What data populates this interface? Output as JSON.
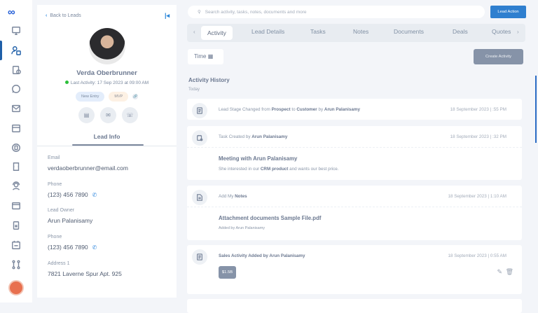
{
  "sidebar": {
    "logo": "GO",
    "icons": [
      "dashboard-icon",
      "leads-icon",
      "invoice-icon",
      "whatsapp-icon",
      "mail-icon",
      "store-icon",
      "document-icon",
      "ticket-icon",
      "support-icon",
      "browser-icon",
      "report-icon",
      "calendar-icon",
      "workflow-icon"
    ],
    "active": "leads-icon"
  },
  "lead": {
    "back": "Back to Leads",
    "name": "Verda Oberbrunner",
    "last_activity": "Last Activity: 17 Sep 2023 at 09:00 AM",
    "tags": [
      "New Entry",
      "MVP"
    ],
    "section": "Lead Info",
    "fields": [
      {
        "label": "Email",
        "value": "verdaoberbrunner@email.com"
      },
      {
        "label": "Phone",
        "value": "(123) 456 7890"
      },
      {
        "label": "Lead Owner",
        "value": "Arun Palanisamy"
      },
      {
        "label": "Phone",
        "value": "(123) 456 7890"
      },
      {
        "label": "Address 1",
        "value": "7821 Laverne Spur Apt. 925"
      }
    ]
  },
  "search": {
    "placeholder": "Search activity, tasks, notes, documents and more"
  },
  "lead_action": "Lead Action",
  "tabs": [
    "Activity",
    "Lead Details",
    "Tasks",
    "Notes",
    "Documents",
    "Deals",
    "Quotes"
  ],
  "time_label": "Time",
  "create_activity": "Create Activity",
  "history": {
    "title": "Activity History",
    "group": "Today"
  },
  "activities": [
    {
      "pre": "Lead Stage Changed from ",
      "b1": "Prospect",
      "mid": " to ",
      "b2": "Customer",
      "mid2": " by ",
      "b3": "Arun Palanisamy",
      "date": "18 September 2023 | :55 PM"
    },
    {
      "pre": "Task Created by ",
      "b1": "Arun Palanisamy",
      "date": "18 September 2023 | :32 PM",
      "title": "Meeting with Arun Palanisamy",
      "s_pre": "She interested in our ",
      "s_b": "CRM product",
      "s_post": " and wants our best price."
    },
    {
      "pre": "Add My ",
      "b1": "Notes",
      "date": "18 September 2023 | 1:10 AM",
      "title": "Attachment documents Sample File.pdf",
      "sub": "Added by Arun Palanisamy"
    },
    {
      "b1": "Sales Activity Added by Arun Palanisamy",
      "date": "18 September 2023 | 0:55 AM",
      "amount": "$1.5B"
    }
  ]
}
